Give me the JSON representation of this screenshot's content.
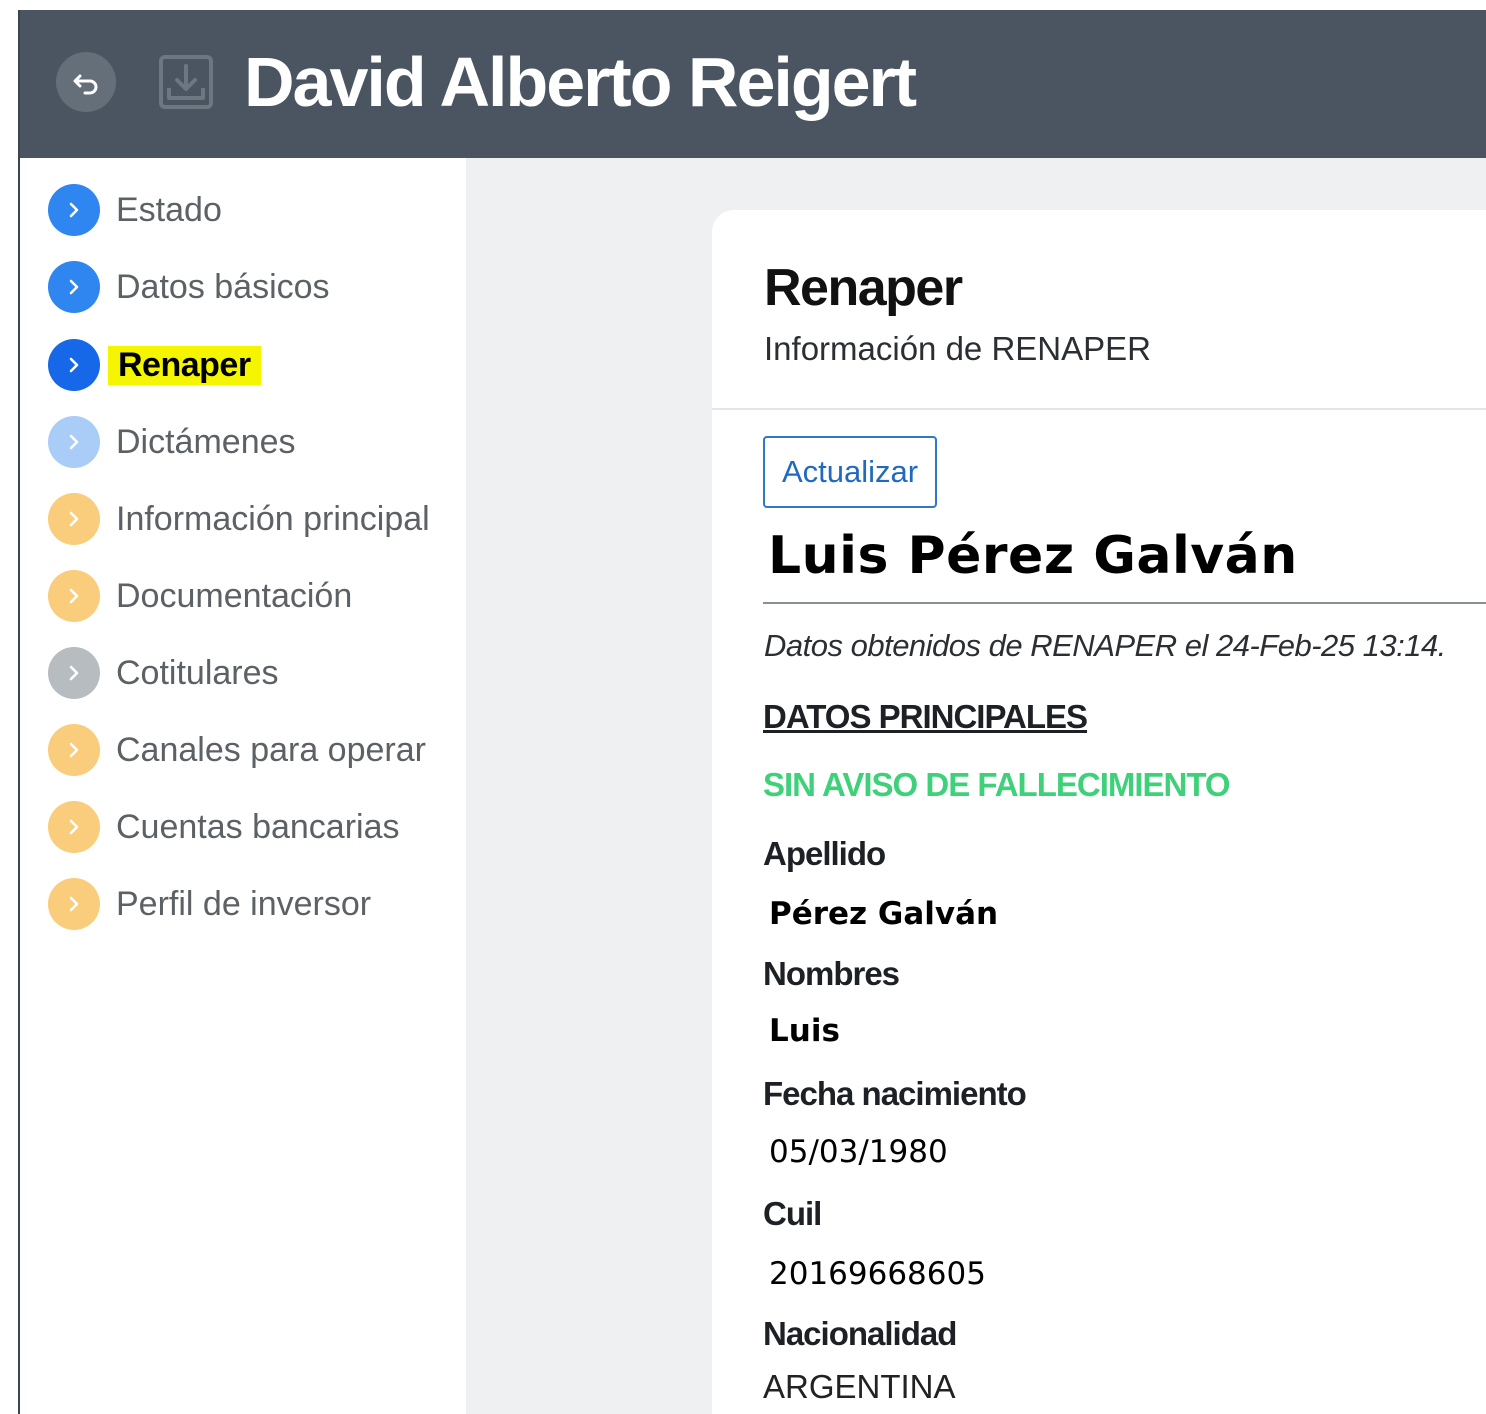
{
  "header": {
    "title": "David Alberto Reigert",
    "back_icon": "undo-arrow-icon",
    "download_icon": "download-tray-icon",
    "background": "#4a5561"
  },
  "sidebar": {
    "items": [
      {
        "label": "Estado",
        "color": "#2f86f0",
        "active": false
      },
      {
        "label": "Datos básicos",
        "color": "#2f86f0",
        "active": false
      },
      {
        "label": "Renaper",
        "color": "#1668e8",
        "active": true
      },
      {
        "label": "Dictámenes",
        "color": "#a9cdf6",
        "active": false
      },
      {
        "label": "Información principal",
        "color": "#f9cd7c",
        "active": false
      },
      {
        "label": "Documentación",
        "color": "#f9cd7c",
        "active": false
      },
      {
        "label": "Cotitulares",
        "color": "#b7bcc1",
        "active": false
      },
      {
        "label": "Canales para operar",
        "color": "#f9cd7c",
        "active": false
      },
      {
        "label": "Cuentas bancarias",
        "color": "#f9cd7c",
        "active": false
      },
      {
        "label": "Perfil de inversor",
        "color": "#f9cd7c",
        "active": false
      }
    ],
    "highlight_color": "#f5f500"
  },
  "card": {
    "title": "Renaper",
    "subtitle": "Información de RENAPER",
    "refresh_label": "Actualizar",
    "person_name": "Luis Pérez Galván",
    "source_note": "Datos obtenidos de RENAPER el 24-Feb-25 13:14.",
    "section_title": "DATOS PRINCIPALES",
    "status": "SIN AVISO DE FALLECIMIENTO",
    "status_color": "#3fd17a",
    "fields": [
      {
        "label": "Apellido",
        "value": "Pérez Galván"
      },
      {
        "label": "Nombres",
        "value": "Luis"
      },
      {
        "label": "Fecha nacimiento",
        "value": "05/03/1980"
      },
      {
        "label": "Cuil",
        "value": "20169668605"
      },
      {
        "label": "Nacionalidad",
        "value": "ARGENTINA"
      }
    ]
  }
}
